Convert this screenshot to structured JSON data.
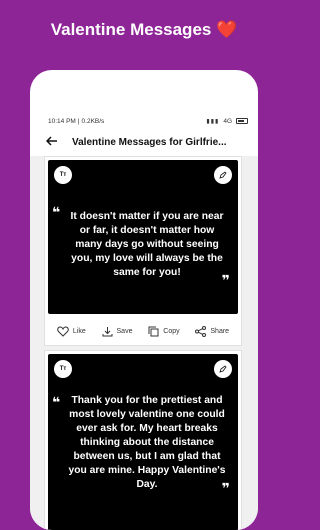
{
  "promo": {
    "title": "Valentine Messages",
    "heart": "❤️"
  },
  "status_bar": {
    "time": "10:14 PM",
    "speed": "0.2KB/s",
    "network": "4G"
  },
  "app_bar": {
    "title": "Valentine Messages for Girlfrie..."
  },
  "cards": [
    {
      "badge": "Tт",
      "message": "It doesn't matter if you are near or far, it doesn't matter how many days go without seeing you, my love will always be the same for you!"
    },
    {
      "badge": "Tт",
      "message": "Thank you for the prettiest and most lovely valentine one could ever ask for. My heart breaks thinking about the distance between us, but I am glad that you are mine. Happy Valentine's Day."
    }
  ],
  "actions": {
    "like": "Like",
    "save": "Save",
    "copy": "Copy",
    "share": "Share"
  },
  "colors": {
    "background": "#8e2596",
    "card": "#000000",
    "text": "#ffffff"
  }
}
